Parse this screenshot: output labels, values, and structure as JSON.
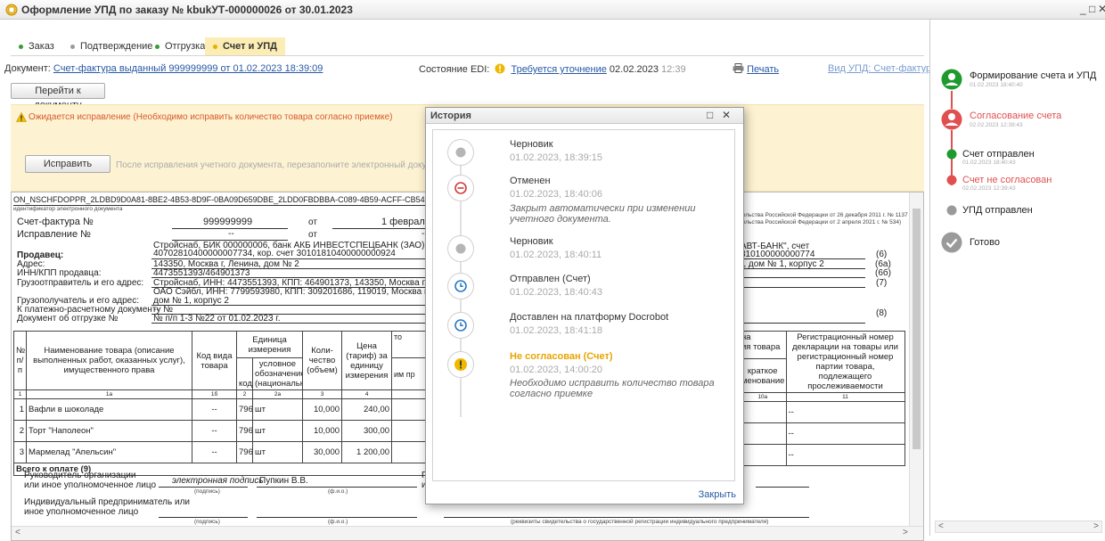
{
  "window": {
    "title": "Оформление УПД по заказу № kbukУТ-000000026 от 30.01.2023"
  },
  "tabs": [
    {
      "label": "Заказ",
      "dot": "#3a9a3a"
    },
    {
      "label": "Подтверждение",
      "dot": "#9a9a9a"
    },
    {
      "label": "Отгрузка",
      "dot": "#3a9a3a"
    },
    {
      "label": "Счет и УПД",
      "dot": "#e8b000"
    }
  ],
  "header": {
    "doc_label": "Документ:",
    "doc_link": "Счет-фактура выданный 999999999 от 01.02.2023 18:39:09",
    "edi_label": "Состояние EDI:",
    "edi_status": "Требуется уточнение",
    "edi_date": "02.02.2023",
    "edi_time": "12:39",
    "print_label": "Печать",
    "upd_view": "Вид УПД: Счет-фактура",
    "goto_button": "Перейти к документу"
  },
  "warning": {
    "text": "Ожидается исправление (Необходимо исправить количество товара согласно приемке)",
    "fix_button": "Исправить",
    "hint": "После исправления учетного документа, перезаполните электронный документ и отправ"
  },
  "document": {
    "id_line": "ON_NSCHFDOPPR_2LDBD9D0A81-8BE2-4B53-8D9F-0BA09D659DBE_2LDD0FBDBBA-C089-4B59-ACFF-CB54FA3F30BD_20230201_78a2d7",
    "id_caption": "идентификатор электронного документа",
    "invoice_label": "Счет-фактура №",
    "invoice_no": "999999999",
    "from": "от",
    "invoice_date": "1 февраля 2",
    "correction_label": "Исправление №",
    "dash": "--",
    "seller_bank": "Стройснаб, БИК 000000006, банк АКБ ИНВЕСТСПЕЦБАНК (ЗАО), счет",
    "seller_acc": "40702810400000007734, кор. счет 30101810400000000924",
    "seller_label": "Продавец:",
    "address_label": "Адрес:",
    "address": "143350, Москва г, Ленина, дом № 2",
    "inn_label": "ИНН/КПП продавца:",
    "inn": "4473551393/464901373",
    "shipper_label": "Грузоотправитель и его адрес:",
    "shipper": "Стройснаб, ИНН: 4473551393, КПП: 464901373, 143350, Москва г, Ленина, до",
    "consignee_line1": "ОАО Сэйбл, ИНН: 7799593980, КПП: 309201686, 119019, Москва г, Москва, А",
    "consignee_label": "Грузополучатель и его адрес:",
    "consignee_line2": "дом № 1, корпус 2",
    "payment_label": "К платежно-расчетному документу №",
    "shipment_label": "Документ об отгрузке №",
    "shipment": "№ п/п 1-3 №22 от 01.02.2023 г.",
    "right_note1": "тельства Российской Федерации от 26 декабря 2011 г. № 1137",
    "right_note2": "тельства Российской Федерации от 2 апреля 2021 г. № 534)",
    "buyer_bank": "АВТ-БАНК\", счет",
    "buyer_acc": "810100000000774",
    "buyer_addr": "), дом № 1, корпус 2",
    "codes": [
      "(6)",
      "(6а)",
      "(6б)",
      "(7)",
      "(8)"
    ],
    "table": {
      "h_no": "№ п/ п",
      "h_name": "Наименование товара (описание выполненных работ, оказанных услуг), имущественного права",
      "h_code": "Код вида товара",
      "h_unit": "Единица измерения",
      "h_unit_code": "код",
      "h_unit_name": "условное обозначение (национальное)",
      "h_qty": "Коли- чество (объем)",
      "h_price": "Цена (тариф) за единицу измерения",
      "h_cut1": "то",
      "h_cut2": "им пр",
      "h_origin_a": "на",
      "h_origin_b": "ия товара",
      "h_origin_c": "краткое",
      "h_origin_d": "менование",
      "h_reg": "Регистрационный номер декларации на товары или регистрационный номер партии товара, подлежащего прослеживаемости",
      "nums": [
        "1",
        "1а",
        "1б",
        "2",
        "2а",
        "3",
        "4",
        "10а",
        "11"
      ],
      "rows": [
        {
          "no": "1",
          "name": "Вафли в шоколаде",
          "code": "--",
          "ucode": "796",
          "uname": "шт",
          "qty": "10,000",
          "price": "240,00",
          "reg": "--"
        },
        {
          "no": "2",
          "name": "Торт \"Наполеон\"",
          "code": "--",
          "ucode": "796",
          "uname": "шт",
          "qty": "10,000",
          "price": "300,00",
          "reg": "--"
        },
        {
          "no": "3",
          "name": "Мармелад \"Апельсин\"",
          "code": "--",
          "ucode": "796",
          "uname": "шт",
          "qty": "30,000",
          "price": "1 200,00",
          "reg": "--"
        }
      ],
      "total": "Всего к оплате (9)"
    },
    "sign": {
      "head_label1": "Руководитель организации",
      "head_label2": "или иное уполномоченное лицо",
      "el_sign": "электронная подпись",
      "head_name": "Пупкин В.В.",
      "cap_sign": "(подпись)",
      "cap_fio": "(ф.и.о.)",
      "ip_label1": "Индивидуальный предприниматель или",
      "ip_label2": "иное уполномоченное лицо",
      "ip_caption": "(реквизиты свидетельства о государственной регистрации индивидуального предпринимателя)",
      "cut": "Г",
      "cut2": "и"
    }
  },
  "history": {
    "title": "История",
    "close_label": "Закрыть",
    "events": [
      {
        "title": "Черновик",
        "date": "01.02.2023, 18:39:15",
        "note": "",
        "kind": "draft"
      },
      {
        "title": "Отменен",
        "date": "01.02.2023, 18:40:06",
        "note": "Закрыт автоматически при изменении учетного документа.",
        "kind": "cancel"
      },
      {
        "title": "Черновик",
        "date": "01.02.2023, 18:40:11",
        "note": "",
        "kind": "draft"
      },
      {
        "title": "Отправлен (Счет)",
        "date": "01.02.2023, 18:40:43",
        "note": "",
        "kind": "clock"
      },
      {
        "title": "Доставлен на платформу Docrobot",
        "date": "01.02.2023, 18:41:18",
        "note": "",
        "kind": "clock"
      },
      {
        "title": "Не согласован (Счет)",
        "date": "01.02.2023, 14:00:20",
        "note": "Необходимо исправить количество товара согласно приемке",
        "kind": "warn"
      }
    ]
  },
  "stages": [
    {
      "name": "Формирование счета и УПД",
      "date": "01.02.2023 18:40:40"
    },
    {
      "name": "Согласование счета",
      "date": "02.02.2023 12:39:43"
    },
    {
      "name": "Счет отправлен",
      "date": "01.02.2023 18:40:43"
    },
    {
      "name": "Счет не согласован",
      "date": "02.02.2023 12:39:43"
    },
    {
      "name": "УПД отправлен",
      "date": ""
    },
    {
      "name": "Готово",
      "date": ""
    }
  ],
  "colors": {
    "green": "#1f9a2e",
    "red": "#e05050",
    "gray": "#9a9a9a",
    "warn": "#f0b800",
    "link": "#2858a4"
  }
}
